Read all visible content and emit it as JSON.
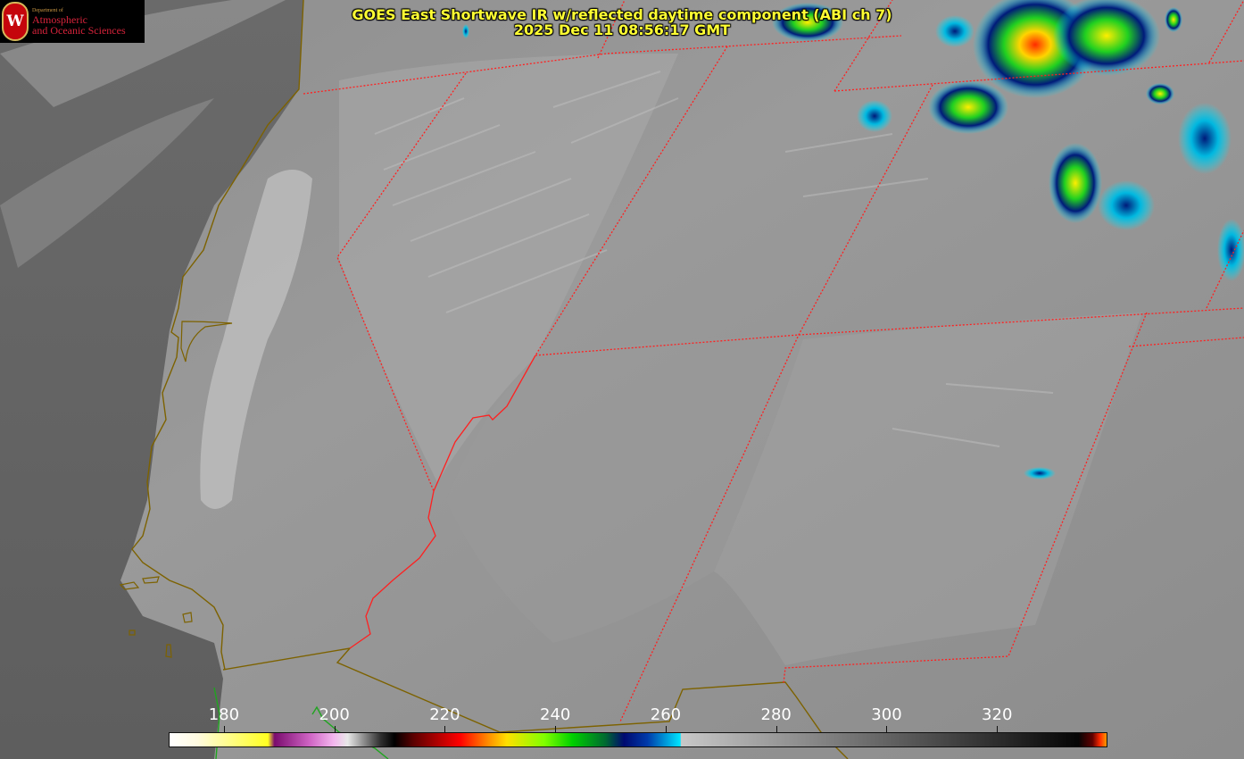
{
  "title": {
    "line1": "GOES East Shortwave IR w/reflected daytime component (ABI ch 7)",
    "line2": "2025 Dec 11 08:56:17 GMT"
  },
  "logo": {
    "seal_letter": "W",
    "dept": "Department of",
    "line1": "Atmospheric",
    "line2": "and Oceanic Sciences"
  },
  "colorbar": {
    "min": 170,
    "max": 340,
    "ticks": [
      "180",
      "200",
      "220",
      "240",
      "260",
      "280",
      "300",
      "320"
    ],
    "tick_values": [
      180,
      200,
      220,
      240,
      260,
      280,
      300,
      320
    ],
    "colors": {
      "warm_end": "#ff0000",
      "mid_cyan": "#00e5ff",
      "cold_white": "#ffffff"
    }
  },
  "map": {
    "state_border_color": "#ff2020",
    "coast_color": "#8a6d00",
    "water_color": "#1fa51f"
  }
}
